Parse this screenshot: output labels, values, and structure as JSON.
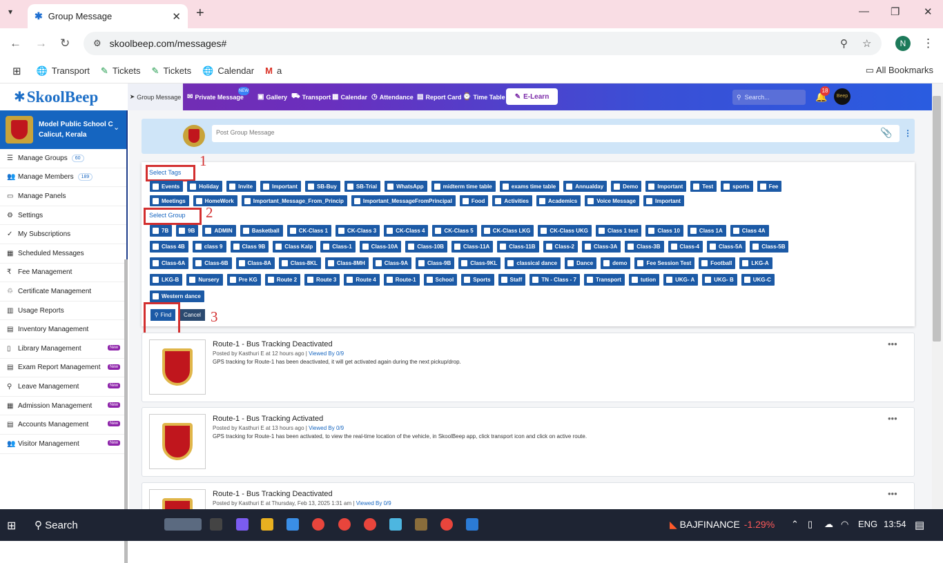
{
  "browser": {
    "tab_title": "Group Message",
    "url": "skoolbeep.com/messages#",
    "profile_initial": "N",
    "bookmarks": [
      "Transport",
      "Tickets",
      "Tickets",
      "Calendar",
      "a"
    ],
    "all_bookmarks": "All Bookmarks"
  },
  "app": {
    "logo": "SkoolBeep",
    "nav": [
      "Group Message",
      "Private Message",
      "Gallery",
      "Transport",
      "Calendar",
      "Attendance",
      "Report Card",
      "Time Table"
    ],
    "nav_badge": "NEW",
    "elearn": "E-Learn",
    "search_placeholder": "Search...",
    "notif_count": "18",
    "user_avatar": "Beep"
  },
  "sidebar": {
    "school_name": "Model Public School C",
    "school_city": "Calicut, Kerala",
    "items": [
      {
        "label": "Manage Groups",
        "count": "60",
        "icon": "list-icon"
      },
      {
        "label": "Manage Members",
        "count": "189",
        "icon": "users-icon"
      },
      {
        "label": "Manage Panels",
        "icon": "monitor-icon"
      },
      {
        "label": "Settings",
        "icon": "gear-icon"
      },
      {
        "label": "My Subscriptions",
        "icon": "check-icon"
      },
      {
        "label": "Scheduled Messages",
        "icon": "calendar-icon"
      },
      {
        "label": "Fee Management",
        "icon": "money-icon"
      },
      {
        "label": "Certificate Management",
        "icon": "certificate-icon"
      },
      {
        "label": "Usage Reports",
        "icon": "chart-icon"
      },
      {
        "label": "Inventory Management",
        "icon": "box-icon"
      },
      {
        "label": "Library Management",
        "badge": "New",
        "icon": "book-icon"
      },
      {
        "label": "Exam Report Management",
        "badge": "New",
        "icon": "doc-icon"
      },
      {
        "label": "Leave Management",
        "badge": "New",
        "icon": "person-icon"
      },
      {
        "label": "Admission Management",
        "badge": "New",
        "icon": "form-icon"
      },
      {
        "label": "Accounts Management",
        "badge": "New",
        "icon": "ledger-icon"
      },
      {
        "label": "Visitor Management",
        "badge": "New",
        "icon": "visitors-icon"
      }
    ]
  },
  "post": {
    "placeholder": "Post Group Message"
  },
  "filters": {
    "tags_label": "Select Tags",
    "group_label": "Select Group",
    "tags_row1": [
      "Events",
      "Holiday",
      "Invite",
      "Important",
      "SB-Buy",
      "SB-Trial",
      "WhatsApp",
      "midterm time table",
      "exams time table",
      "Annualday",
      "Demo",
      "Important",
      "Test",
      "sports",
      "Fee"
    ],
    "tags_row2": [
      "Meetings",
      "HomeWork",
      "Important_Message_From_Princip",
      "Important_MessageFromPrincipal",
      "Food",
      "Activities",
      "Academics",
      "Voice Message",
      "Important"
    ],
    "groups_row1": [
      "7B",
      "9B",
      "ADMIN",
      "Basketball",
      "CK-Class 1",
      "CK-Class 3",
      "CK-Class 4",
      "CK-Class 5",
      "CK-Class LKG",
      "CK-Class UKG",
      "Class 1 test",
      "Class 10",
      "Class 1A",
      "Class 4A"
    ],
    "groups_row2": [
      "Class 4B",
      "class 9",
      "Class 9B",
      "Class Kalp",
      "Class-1",
      "Class-10A",
      "Class-10B",
      "Class-11A",
      "Class-11B",
      "Class-2",
      "Class-3A",
      "Class-3B",
      "Class-4",
      "Class-5A",
      "Class-5B"
    ],
    "groups_row3": [
      "Class-6A",
      "Class-6B",
      "Class-8A",
      "Class-8KL",
      "Class-8MH",
      "Class-9A",
      "Class-9B",
      "Class-9KL",
      "classical dance",
      "Dance",
      "demo",
      "Fee Session Test",
      "Football",
      "LKG-A"
    ],
    "groups_row4": [
      "LKG-B",
      "Nursery",
      "Pre KG",
      "Route 2",
      "Route 3",
      "Route 4",
      "Route-1",
      "School",
      "Sports",
      "Staff",
      "TN - Class - 7",
      "Transport",
      "tution",
      "UKG- A",
      "UKG- B",
      "UKG-C"
    ],
    "groups_row5": [
      "Western dance"
    ],
    "find": "Find",
    "cancel": "Cancel",
    "markers": [
      "1",
      "2",
      "3"
    ]
  },
  "messages": [
    {
      "title": "Route-1 - Bus Tracking Deactivated",
      "meta": "Posted by Kasthuri E at 12 hours ago  |",
      "viewed": "Viewed By 0/9",
      "body": "GPS tracking for Route-1 has been deactivated, it will get activated again during the next pickup/drop."
    },
    {
      "title": "Route-1 - Bus Tracking Activated",
      "meta": "Posted by Kasthuri E at 13 hours ago  |",
      "viewed": "Viewed By 0/9",
      "body": "GPS tracking for Route-1 has been activated, to view the real-time location of the vehicle, in SkoolBeep app, click transport icon and click on active route."
    },
    {
      "title": "Route-1 - Bus Tracking Deactivated",
      "meta": "Posted by Kasthuri E at Thursday, Feb 13, 2025 1:31 am  |",
      "viewed": "Viewed By 0/9",
      "body": ""
    }
  ],
  "taskbar": {
    "search": "Search",
    "stock_name": "BAJFINANCE",
    "stock_change": "-1.29%",
    "lang": "ENG",
    "time": "13:54"
  },
  "colors": {
    "tag_bg": "#1c5aa6",
    "header_start": "#7b2aa8",
    "header_end": "#2a5ce0",
    "marker": "#d32f2f"
  }
}
